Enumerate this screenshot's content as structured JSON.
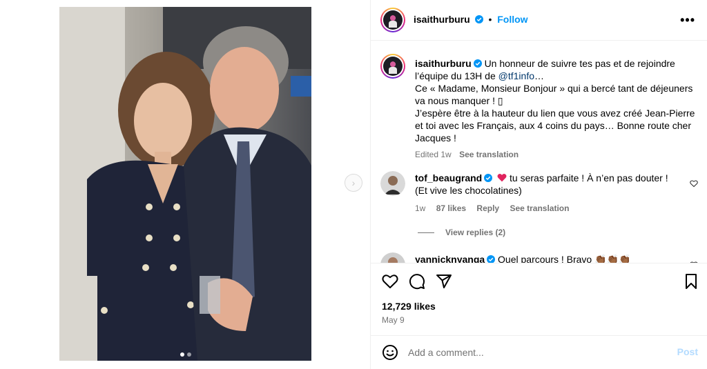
{
  "post": {
    "username": "isaithurburu",
    "follow_label": "Follow",
    "bullet": "•",
    "more_label": "•••"
  },
  "caption": {
    "username": "isaithurburu",
    "line1": "Un honneur de suivre tes pas et de rejoindre l’équipe du 13H de",
    "mention": "@tf1info",
    "line1_end": "…",
    "line2": "Ce « Madame, Monsieur Bonjour » qui a bercé tant de déjeuners va nous manquer ! ▯",
    "line3": "J’espère être à la hauteur du lien que vous avez créé Jean-Pierre et toi avec les Français, aux 4 coins du pays… Bonne route cher Jacques !",
    "edited": "Edited",
    "time": "1w",
    "see_translation": "See translation"
  },
  "comments": [
    {
      "username": "tof_beaugrand",
      "text": "tu seras parfaite ! À n’en pas douter ! (Et vive les chocolatines)",
      "time": "1w",
      "likes": "87 likes",
      "reply": "Reply",
      "see_translation": "See translation",
      "view_replies": "View replies (2)"
    },
    {
      "username": "yannicknyanga",
      "text": "Quel parcours ! Bravo"
    }
  ],
  "actions": {
    "likes": "12,729 likes",
    "date": "May 9"
  },
  "add_comment": {
    "placeholder": "Add a comment...",
    "post_label": "Post"
  },
  "icons": {
    "next": "chevron-right-icon",
    "like": "heart-icon",
    "comment": "comment-icon",
    "share": "send-icon",
    "save": "bookmark-icon",
    "emoji": "emoji-icon"
  },
  "colors": {
    "link": "#0095f6",
    "mention": "#00376b",
    "muted": "#737373",
    "post_disabled": "#b3dbff",
    "heart_red": "#ff3040"
  }
}
